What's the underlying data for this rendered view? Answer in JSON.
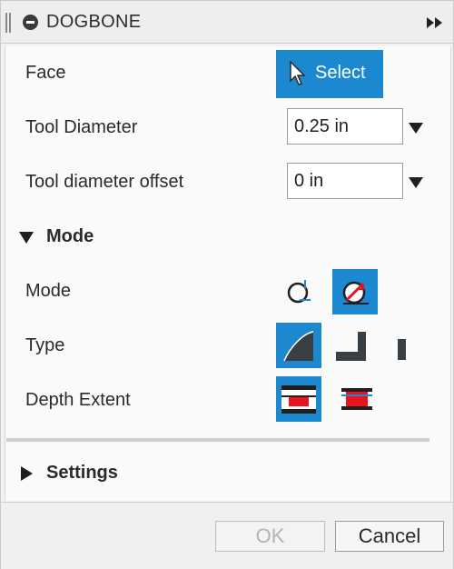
{
  "panel": {
    "title": "DOGBONE"
  },
  "face": {
    "label": "Face",
    "button_label": "Select"
  },
  "tool_diameter": {
    "label": "Tool Diameter",
    "value": "0.25 in"
  },
  "tool_diameter_offset": {
    "label": "Tool diameter offset",
    "value": "0 in"
  },
  "mode_section": {
    "heading": "Mode",
    "mode": {
      "label": "Mode",
      "options": [
        "normal-dogbone-icon",
        "minimal-dogbone-icon"
      ],
      "selected_index": 1
    },
    "type": {
      "label": "Type",
      "options": [
        "radius-corner-icon",
        "square-corner-icon",
        "slot-icon"
      ],
      "selected_index": 0
    },
    "depth_extent": {
      "label": "Depth Extent",
      "options": [
        "full-depth-icon",
        "partial-depth-icon"
      ],
      "selected_index": 0
    }
  },
  "settings_section": {
    "heading": "Settings"
  },
  "footer": {
    "ok_label": "OK",
    "cancel_label": "Cancel"
  },
  "colors": {
    "accent": "#1b88d0",
    "highlight_red": "#e8141e"
  }
}
